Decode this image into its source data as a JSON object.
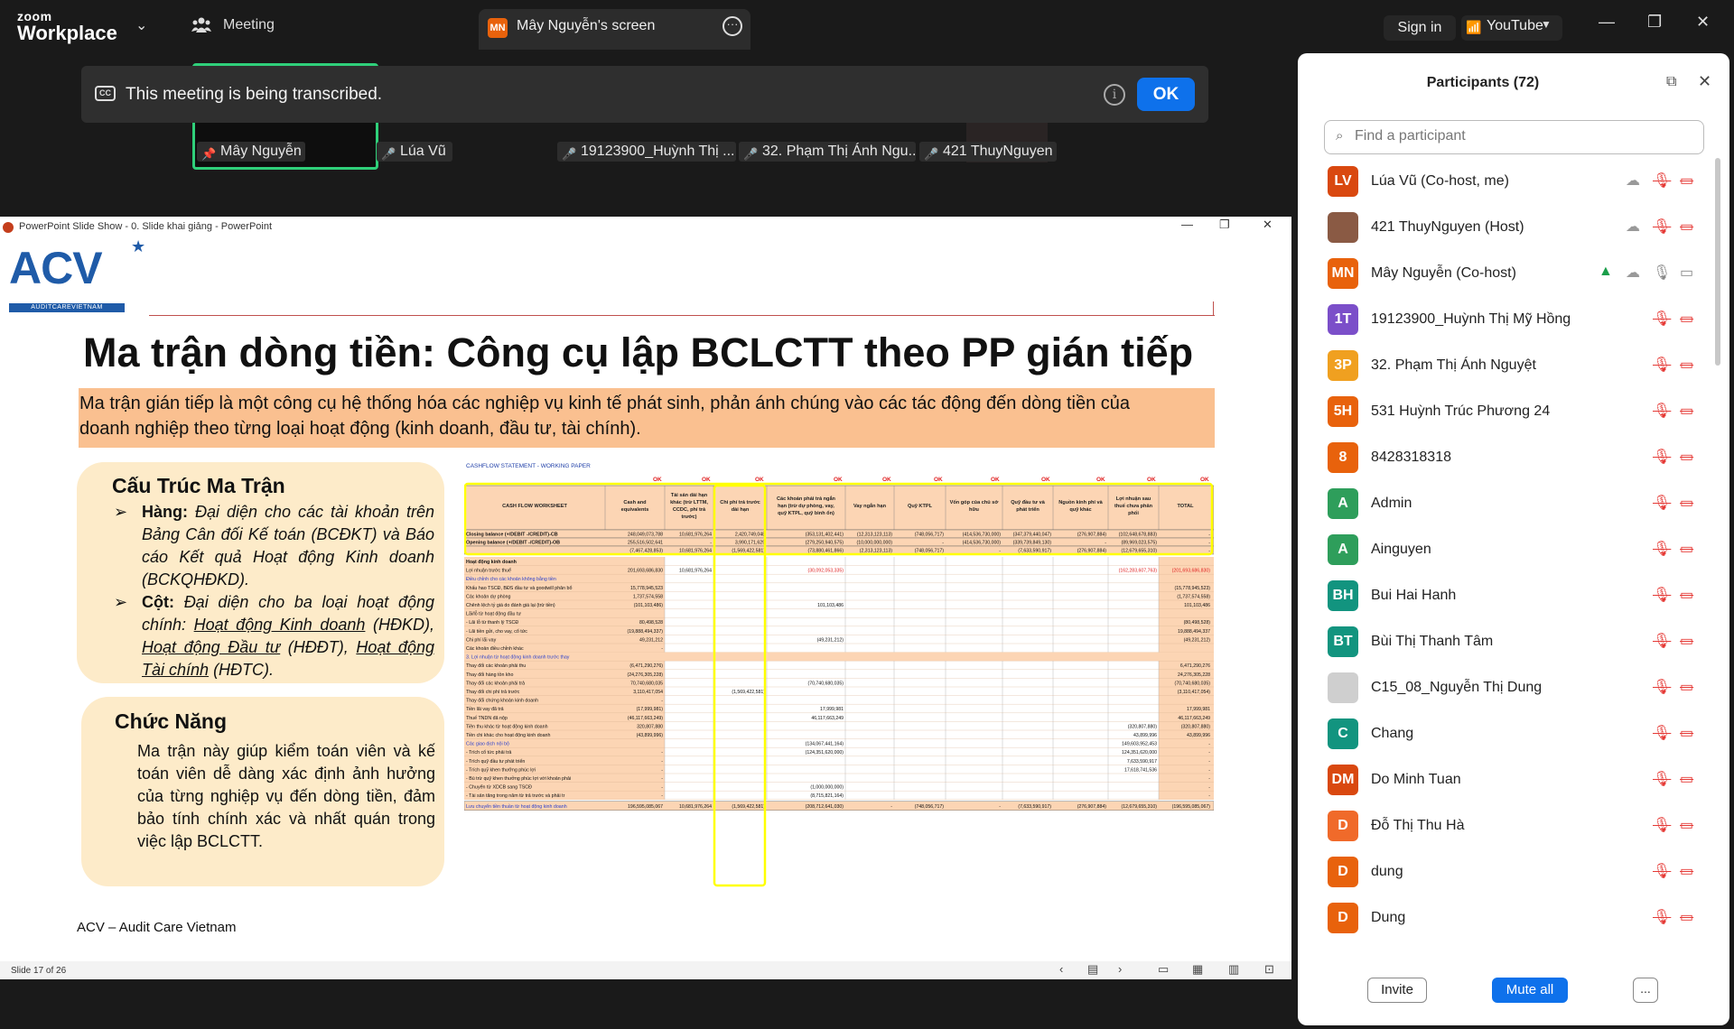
{
  "app": {
    "brand_top": "zoom",
    "brand_bottom": "Workplace"
  },
  "topbar": {
    "meeting_label": "Meeting",
    "screen_badge": "MN",
    "screen_label": "Mây Nguyễn's screen",
    "signin_label": "Sign in",
    "youtube_label": "YouTube"
  },
  "banner": {
    "text": "This meeting is being transcribed.",
    "ok_label": "OK"
  },
  "video_tags": [
    {
      "name": "Mây Nguyễn"
    },
    {
      "name": "Lúa Vũ"
    },
    {
      "name": "19123900_Huỳnh Thị ..."
    },
    {
      "name": "32. Phạm Thị Ánh Ngu..."
    },
    {
      "name": "421 ThuyNguyen"
    }
  ],
  "ppt": {
    "window_title": "PowerPoint Slide Show  -  0. Slide khai giảng - PowerPoint",
    "slide_number": "Slide 17 of 26"
  },
  "slide": {
    "logo_text": "ACV",
    "logo_sub": "AUDITCAREVIETNAM",
    "title": "Ma trận dòng tiền: Công cụ lập BCLCTT theo PP gián tiếp",
    "subtitle_line1": "Ma trận gián tiếp là một công cụ hệ thống hóa các nghiệp vụ kinh tế phát sinh, phản ánh chúng vào các tác động đến dòng tiền của",
    "subtitle_line2": "doanh nghiệp theo từng loại hoạt động (kinh doanh, đầu tư, tài chính).",
    "structure_title": "Cấu Trúc Ma Trận",
    "row_label": "Hàng:",
    "row_text": "Đại diện cho các tài khoản trên Bảng Cân đối Kế toán (BCĐKT) và Báo cáo Kết quả Hoạt động Kinh doanh (BCKQHĐKD).",
    "col_label": "Cột:",
    "col_text_1": "Đại diện cho ba loại hoạt động chính:",
    "col_link_1": "Hoạt động Kinh doanh",
    "col_abbr_1": "(HĐKD),",
    "col_link_2": "Hoạt động Đầu tư",
    "col_abbr_2": "(HĐĐT),",
    "col_link_3": "Hoạt động Tài chính",
    "col_abbr_3": "(HĐTC).",
    "function_title": "Chức Năng",
    "function_text": "Ma trận này giúp kiểm toán viên và kế toán viên dễ dàng xác định ảnh hưởng của từng nghiệp vụ đến dòng tiền, đảm bảo tính chính xác và nhất quán trong việc lập BCLCTT.",
    "footer": "ACV – Audit Care Vietnam"
  },
  "sheet": {
    "caption": "CASHFLOW STATEMENT - WORKING PAPER",
    "ok_marks": [
      "OK",
      "OK",
      "OK",
      "OK",
      "OK",
      "OK",
      "OK",
      "OK",
      "OK",
      "OK",
      "OK"
    ],
    "headers": [
      "CASH FLOW WORKSHEET",
      "Cash and equivalents",
      "Tài sản dài hạn khác (trừ LTTM, CCDC, phí trả trước)",
      "Chi phí trả trước dài hạn",
      "Các khoản phải trả ngắn hạn (trừ dự phòng, vay, quỹ KTPL, quỹ bình ổn)",
      "Vay ngắn hạn",
      "Quỹ KTPL",
      "Vốn góp của chủ sở hữu",
      "Quỹ đầu tư và phát triển",
      "Nguồn kinh phí và quỹ khác",
      "Lợi nhuận sau thuế chưa phân phối",
      "TOTAL"
    ],
    "balance_rows": [
      {
        "label": "Closing balance (+/DEBIT -/CREDIT)-CB",
        "v1": "248,049,073,788",
        "v2": "10,681,976,264",
        "v3": "2,420,749,048",
        "v4": "(353,131,402,441)",
        "v5": "(12,313,123,113)",
        "v6": "(748,056,717)",
        "v7": "(414,536,730,000)",
        "v8": "(347,379,440,047)",
        "v9": "(276,907,884)",
        "v10": "(102,648,678,883)",
        "v11": "-"
      },
      {
        "label": "Opening balance (+/DEBIT -/CREDIT)-OB",
        "v1": "255,516,502,641",
        "v2": "-",
        "v3": "3,990,171,629",
        "v4": "(279,250,940,575)",
        "v5": "(10,000,000,000)",
        "v6": "-",
        "v7": "(414,536,730,000)",
        "v8": "(339,739,849,130)",
        "v9": "-",
        "v10": "(89,969,023,575)",
        "v11": "-"
      },
      {
        "label": "",
        "v1": "(7,467,428,853)",
        "v2": "10,681,976,264",
        "v3": "(1,569,422,581)",
        "v4": "(73,880,461,866)",
        "v5": "(2,313,123,113)",
        "v6": "(748,056,717)",
        "v7": "-",
        "v8": "(7,633,590,917)",
        "v9": "(276,907,884)",
        "v10": "(12,679,655,310)",
        "v11": "-"
      }
    ],
    "rows": [
      {
        "label": "Hoạt động kinh doanh",
        "v1": "",
        "v2": "",
        "v3": "",
        "v4": "",
        "v10": "",
        "v11": ""
      },
      {
        "label": "Lợi nhuận trước thuế",
        "v1": "201,693,686,830",
        "v2": "10,681,976,264",
        "v3": "",
        "v4": "(30,092,053,335)",
        "v10": "(162,283,607,763)",
        "v11": "(201,693,686,830)"
      },
      {
        "label": "Điều chỉnh cho các khoản không bằng tiền",
        "v1": "",
        "v2": "",
        "v3": "",
        "v4": "",
        "v10": "",
        "v11": ""
      },
      {
        "label": "Khấu hao TSCĐ, BĐS đầu tư và goodwill phân bổ",
        "v1": "15,778,945,523",
        "v2": "",
        "v3": "",
        "v4": "",
        "v10": "",
        "v11": "(15,778,945,523)"
      },
      {
        "label": "Các khoản dự phòng",
        "v1": "1,737,574,558",
        "v2": "",
        "v3": "",
        "v4": "",
        "v10": "",
        "v11": "(1,737,574,558)"
      },
      {
        "label": "Chênh lệch tỷ giá do đánh giá lại (trừ tiền)",
        "v1": "(101,103,486)",
        "v2": "",
        "v3": "",
        "v4": "101,103,486",
        "v10": "",
        "v11": "101,103,486"
      },
      {
        "label": "Lãi/lỗ từ hoạt động đầu tư",
        "v1": "",
        "v2": "",
        "v3": "",
        "v4": "",
        "v10": "",
        "v11": ""
      },
      {
        "label": "- Lãi lỗ từ thanh lý TSCĐ",
        "v1": "80,498,528",
        "v2": "",
        "v3": "",
        "v4": "",
        "v10": "",
        "v11": "(80,498,528)"
      },
      {
        "label": "- Lãi tiền gửi, cho vay, cổ tức",
        "v1": "(19,888,494,337)",
        "v2": "",
        "v3": "",
        "v4": "",
        "v10": "",
        "v11": "19,888,494,337"
      },
      {
        "label": "Chi phí lãi vay",
        "v1": "49,231,212",
        "v2": "",
        "v3": "",
        "v4": "(49,231,212)",
        "v10": "",
        "v11": "(49,231,212)"
      },
      {
        "label": "Các khoản điều chỉnh khác",
        "v1": "-",
        "v2": "",
        "v3": "",
        "v4": "",
        "v10": "",
        "v11": ""
      },
      {
        "label": "3. Lợi nhuận từ hoạt động kinh doanh trước thay đổi vốn lưu động",
        "v1": "",
        "v2": "",
        "v3": "",
        "v4": "",
        "v10": "",
        "v11": ""
      },
      {
        "label": "Thay đổi các khoản phải thu",
        "v1": "(6,471,290,276)",
        "v2": "",
        "v3": "",
        "v4": "",
        "v10": "",
        "v11": "6,471,290,276"
      },
      {
        "label": "Thay đổi hàng tồn kho",
        "v1": "(24,276,305,228)",
        "v2": "",
        "v3": "",
        "v4": "",
        "v10": "",
        "v11": "24,276,305,228"
      },
      {
        "label": "Thay đổi các khoản phải trả",
        "v1": "70,740,680,035",
        "v2": "",
        "v3": "",
        "v4": "(70,740,680,035)",
        "v10": "",
        "v11": "(70,740,680,035)"
      },
      {
        "label": "Thay đổi chi phí trả trước",
        "v1": "3,110,417,054",
        "v2": "",
        "v3": "(1,569,422,581)",
        "v4": "",
        "v10": "",
        "v11": "(3,110,417,054)"
      },
      {
        "label": "Thay đổi chứng khoán kinh doanh",
        "v1": "-",
        "v2": "",
        "v3": "",
        "v4": "",
        "v10": "",
        "v11": ""
      },
      {
        "label": "Tiền lãi vay đã trả",
        "v1": "(17,999,981)",
        "v2": "",
        "v3": "",
        "v4": "17,999,981",
        "v10": "",
        "v11": "17,999,981"
      },
      {
        "label": "Thuế TNDN đã nộp",
        "v1": "(46,117,663,249)",
        "v2": "",
        "v3": "",
        "v4": "46,117,663,249",
        "v10": "",
        "v11": "46,117,663,249"
      },
      {
        "label": "Tiền thu khác từ hoạt động kinh doanh",
        "v1": "320,807,880",
        "v2": "",
        "v3": "",
        "v4": "",
        "v10": "(320,807,880)",
        "v11": "(320,807,880)"
      },
      {
        "label": "Tiền chi khác cho hoạt động kinh doanh",
        "v1": "(43,899,996)",
        "v2": "",
        "v3": "",
        "v4": "",
        "v10": "43,899,996",
        "v11": "43,899,996"
      },
      {
        "label": "Các giao dịch nội bộ",
        "v1": "",
        "v2": "",
        "v3": "",
        "v4": "(134,067,441,164)",
        "v10": "149,603,952,453",
        "v11": "-"
      },
      {
        "label": "- Trích cổ tức phải trả",
        "v1": "-",
        "v2": "",
        "v3": "",
        "v4": "(124,351,620,000)",
        "v10": "124,351,620,000",
        "v11": "-"
      },
      {
        "label": "- Trích quỹ đầu tư phát triển",
        "v1": "-",
        "v2": "",
        "v3": "",
        "v4": "",
        "v10": "7,633,590,917",
        "v11": "-"
      },
      {
        "label": "- Trích quỹ khen thưởng phúc lợi",
        "v1": "-",
        "v2": "",
        "v3": "",
        "v4": "",
        "v10": "17,618,741,536",
        "v11": "-"
      },
      {
        "label": "- Bù trừ quỹ khen thưởng phúc lợi với khoản phải thu khác (đã chi từ năm trước)",
        "v1": "-",
        "v2": "",
        "v3": "",
        "v4": "",
        "v10": "",
        "v11": "-"
      },
      {
        "label": "- Chuyển từ XDCB sang TSCĐ",
        "v1": "-",
        "v2": "",
        "v3": "",
        "v4": "(1,000,000,000)",
        "v10": "",
        "v11": "-"
      },
      {
        "label": "- Tài sản tăng trong năm từ trả trước và phải trả",
        "v1": "-",
        "v2": "",
        "v3": "",
        "v4": "(8,715,821,164)",
        "v10": "",
        "v11": "-"
      }
    ],
    "total_row": {
      "label": "Lưu chuyển tiền thuần từ hoạt động kinh doanh",
      "v1": "196,595,085,067",
      "v2": "10,681,976,264",
      "v3": "(1,569,422,581)",
      "v4": "(208,712,641,030)",
      "v5": "-",
      "v6": "(748,056,717)",
      "v7": "-",
      "v8": "(7,633,590,917)",
      "v9": "(276,907,884)",
      "v10": "(12,679,655,310)",
      "v11": "(196,595,085,067)"
    }
  },
  "participants": {
    "title": "Participants (72)",
    "search_placeholder": "Find a participant",
    "invite_label": "Invite",
    "mute_all_label": "Mute all",
    "more_label": "...",
    "list": [
      {
        "initials": "LV",
        "name": "Lúa Vũ (Co-host, me)",
        "color": "#d9480f",
        "muted": true,
        "video_off": true
      },
      {
        "initials": "",
        "name": "421 ThuyNguyen (Host)",
        "color": "#8a5a44",
        "muted": true,
        "video_off": true
      },
      {
        "initials": "MN",
        "name": "Mây Nguyễn (Co-host)",
        "color": "#e8620c",
        "muted": false,
        "video_off": false,
        "sharing": true
      },
      {
        "initials": "1T",
        "name": "19123900_Huỳnh Thị Mỹ Hồng",
        "color": "#7b4fc9",
        "muted": true,
        "video_off": true
      },
      {
        "initials": "3P",
        "name": "32. Phạm Thị Ánh Nguyệt",
        "color": "#f0a020",
        "muted": true,
        "video_off": true
      },
      {
        "initials": "5H",
        "name": "531 Huỳnh Trúc Phương 24",
        "color": "#e8620c",
        "muted": true,
        "video_off": true
      },
      {
        "initials": "8",
        "name": "8428318318",
        "color": "#e8620c",
        "muted": true,
        "video_off": true
      },
      {
        "initials": "A",
        "name": "Admin",
        "color": "#2e9e5b",
        "muted": true,
        "video_off": true
      },
      {
        "initials": "A",
        "name": "Ainguyen",
        "color": "#2e9e5b",
        "muted": true,
        "video_off": true
      },
      {
        "initials": "BH",
        "name": "Bui Hai Hanh",
        "color": "#12947f",
        "muted": true,
        "video_off": true
      },
      {
        "initials": "BT",
        "name": "Bùi Thị Thanh Tâm",
        "color": "#12947f",
        "muted": true,
        "video_off": true
      },
      {
        "initials": "",
        "name": "C15_08_Nguyễn Thị Dung",
        "color": "#cfcfcf",
        "muted": true,
        "video_off": true
      },
      {
        "initials": "C",
        "name": "Chang",
        "color": "#12947f",
        "muted": true,
        "video_off": true
      },
      {
        "initials": "DM",
        "name": "Do Minh Tuan",
        "color": "#d9480f",
        "muted": true,
        "video_off": true
      },
      {
        "initials": "D",
        "name": "Đỗ Thị Thu Hà",
        "color": "#f06a2a",
        "muted": true,
        "video_off": true
      },
      {
        "initials": "D",
        "name": "dung",
        "color": "#e8620c",
        "muted": true,
        "video_off": true
      },
      {
        "initials": "D",
        "name": "Dung",
        "color": "#e8620c",
        "muted": true,
        "video_off": true
      }
    ]
  }
}
